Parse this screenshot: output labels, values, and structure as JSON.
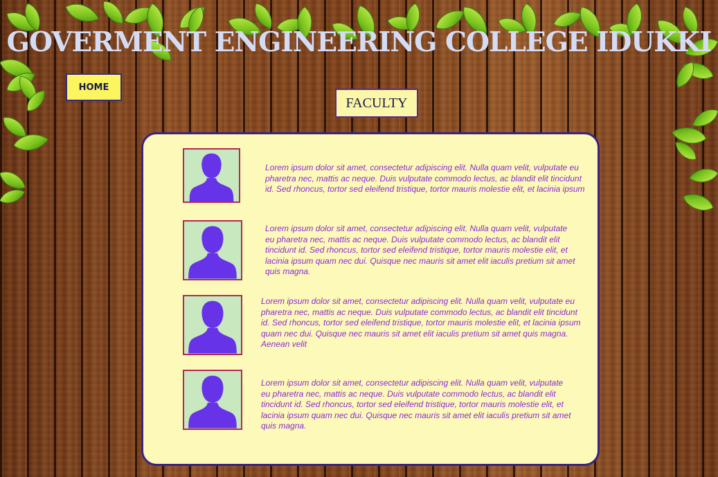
{
  "header": {
    "title": "GOVERMENT ENGINEERING COLLEGE IDUKKI"
  },
  "nav": {
    "home_label": "HOME"
  },
  "section": {
    "heading": "FACULTY"
  },
  "faculty": [
    {
      "avatar_icon": "person-silhouette-icon",
      "bio": "Lorem ipsum dolor sit amet, consectetur adipiscing elit. Nulla quam velit, vulputate eu pharetra nec, mattis ac neque. Duis vulputate commodo lectus, ac blandit elit tincidunt id. Sed rhoncus, tortor sed eleifend tristique, tortor mauris molestie elit, et lacinia ipsum"
    },
    {
      "avatar_icon": "person-silhouette-icon",
      "bio": "Lorem ipsum dolor sit amet, consectetur adipiscing elit. Nulla quam velit, vulputate eu pharetra nec, mattis ac neque. Duis vulputate commodo lectus, ac blandit elit tincidunt id. Sed rhoncus, tortor sed eleifend tristique, tortor mauris molestie elit, et lacinia ipsum quam nec dui. Quisque nec mauris sit amet elit iaculis pretium sit amet quis magna."
    },
    {
      "avatar_icon": "person-silhouette-icon",
      "bio": "Lorem ipsum dolor sit amet, consectetur adipiscing elit. Nulla quam velit, vulputate eu pharetra nec, mattis ac neque. Duis vulputate commodo lectus, ac blandit elit tincidunt id. Sed rhoncus, tortor sed eleifend tristique, tortor mauris molestie elit, et lacinia ipsum quam nec dui. Quisque nec mauris sit amet elit iaculis pretium sit amet quis magna. Aenean velit"
    },
    {
      "avatar_icon": "person-silhouette-icon",
      "bio": "Lorem ipsum dolor sit amet, consectetur adipiscing elit. Nulla quam velit, vulputate eu pharetra nec, mattis ac neque. Duis vulputate commodo lectus, ac blandit elit tincidunt id. Sed rhoncus, tortor sed eleifend tristique, tortor mauris molestie elit, et lacinia ipsum quam nec dui. Quisque nec mauris sit amet elit iaculis pretium sit amet quis magna."
    }
  ],
  "colors": {
    "title": "#d4dcf5",
    "home_button_bg": "#fbf55f",
    "panel_bg": "#fdf9b8",
    "panel_border": "#3a2480",
    "bio_text": "#8a2bd6",
    "avatar_bg": "#c8e8c0",
    "avatar_figure": "#6633e8",
    "avatar_border": "#b02a55"
  },
  "decorations": {
    "background": "wood-planks",
    "foliage": "green-leaves-icon"
  }
}
